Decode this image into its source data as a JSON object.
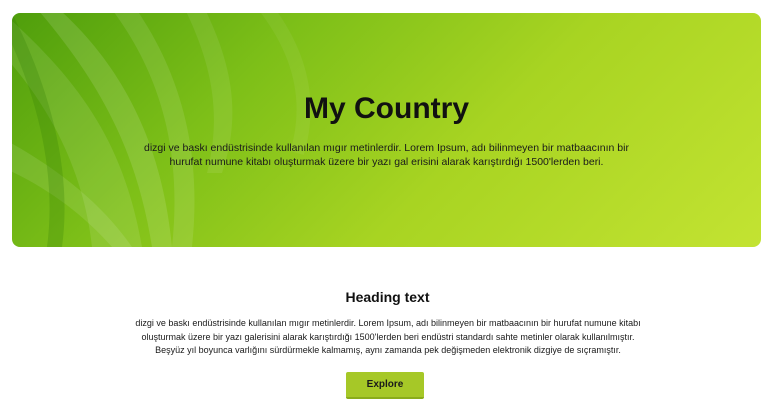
{
  "hero": {
    "title": "My Country",
    "text_line1": "dizgi ve baskı endüstrisinde kullanılan mıgır metinlerdir. Lorem Ipsum, adı bilinmeyen bir matbaacının bir",
    "text_line2": "hurufat numune kitabı   oluşturmak üzere bir yazı gal erisini alarak karıştırdığı 1500'lerden beri.",
    "colors": {
      "dark_green": "#4f9e0c",
      "light_green": "#c3e332"
    }
  },
  "section": {
    "heading": "Heading text",
    "text_line1": "dizgi ve baskı endüstrisinde kullanılan mıgır metinlerdir. Lorem Ipsum, adı bilinmeyen bir matbaacının bir hurufat numune kitabı",
    "text_line2": "oluşturmak üzere bir yazı galerisini alarak karıştırdığı 1500'lerden beri endüstri standardı sahte metinler olarak kullanılmıştır.",
    "text_line3": "Beşyüz yıl boyunca varlığını sürdürmekle kalmamış, aynı zamanda pek değişmeden elektronik dizgiye de sıçramıştır."
  },
  "button": {
    "label": "Explore",
    "color": "#a6c827"
  }
}
